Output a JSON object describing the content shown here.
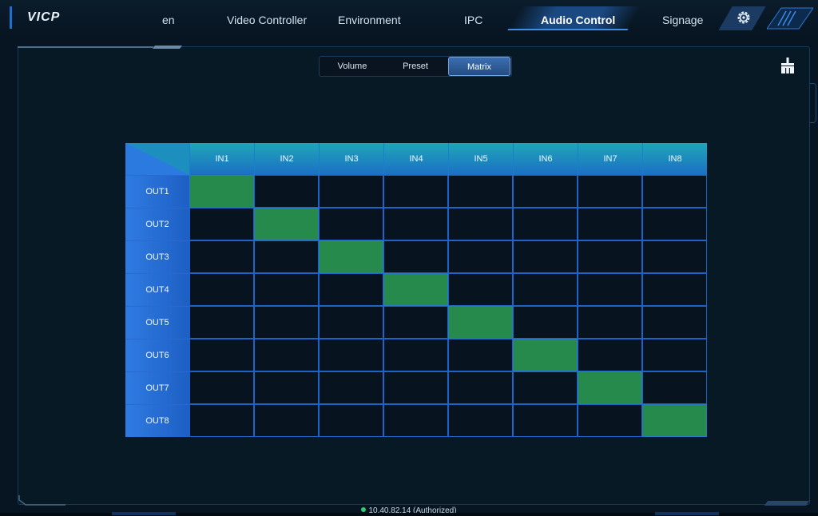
{
  "app": {
    "logo": "VICP"
  },
  "nav": {
    "items": [
      {
        "label": "en",
        "active": false
      },
      {
        "label": "Video Controller",
        "active": false
      },
      {
        "label": "Environment",
        "active": false
      },
      {
        "label": "IPC",
        "active": false
      },
      {
        "label": "Audio Control",
        "active": true
      },
      {
        "label": "Signage",
        "active": false
      }
    ],
    "settings_icon": "gear-icon"
  },
  "subtabs": [
    {
      "label": "Volume",
      "active": false
    },
    {
      "label": "Preset",
      "active": false
    },
    {
      "label": "Matrix",
      "active": true
    }
  ],
  "toolbar": {
    "clear_icon": "broom-icon"
  },
  "matrix": {
    "inputs": [
      "IN1",
      "IN2",
      "IN3",
      "IN4",
      "IN5",
      "IN6",
      "IN7",
      "IN8"
    ],
    "outputs": [
      "OUT1",
      "OUT2",
      "OUT3",
      "OUT4",
      "OUT5",
      "OUT6",
      "OUT7",
      "OUT8"
    ],
    "routes": [
      [
        1,
        0,
        0,
        0,
        0,
        0,
        0,
        0
      ],
      [
        0,
        1,
        0,
        0,
        0,
        0,
        0,
        0
      ],
      [
        0,
        0,
        1,
        0,
        0,
        0,
        0,
        0
      ],
      [
        0,
        0,
        0,
        1,
        0,
        0,
        0,
        0
      ],
      [
        0,
        0,
        0,
        0,
        1,
        0,
        0,
        0
      ],
      [
        0,
        0,
        0,
        0,
        0,
        1,
        0,
        0
      ],
      [
        0,
        0,
        0,
        0,
        0,
        0,
        1,
        0
      ],
      [
        0,
        0,
        0,
        0,
        0,
        0,
        0,
        1
      ]
    ],
    "colors": {
      "active": "#268a4c",
      "grid": "#1d63c8"
    }
  },
  "status": {
    "text": "10.40.82.14 (Authorized)",
    "color": "#2ecc71"
  }
}
